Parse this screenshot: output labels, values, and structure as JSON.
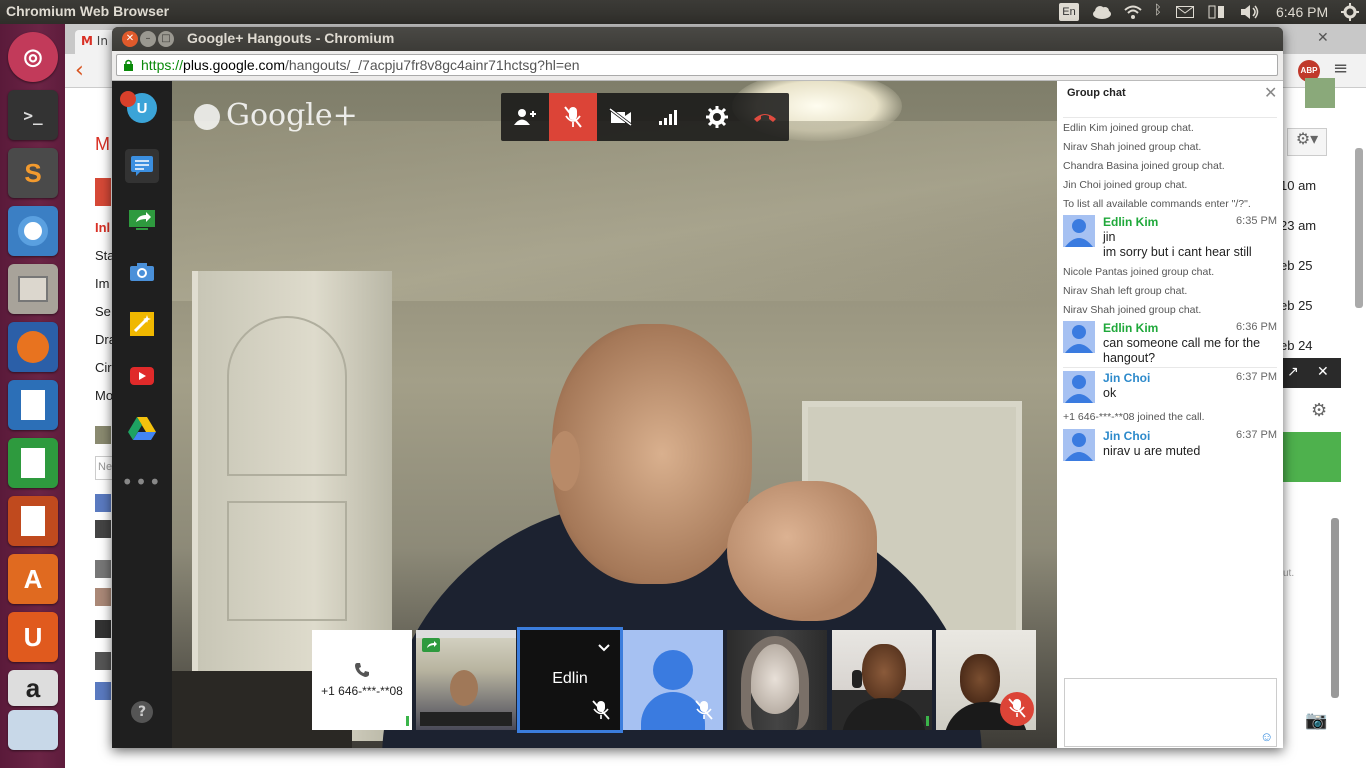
{
  "topbar": {
    "title": "Chromium Web Browser",
    "lang": "En",
    "clock": "6:46 PM"
  },
  "background_browser": {
    "tab_label": "In",
    "gmail_nav": [
      "M",
      "Inl",
      "Sta",
      "Im",
      "Se",
      "Dra",
      "Cir",
      "Mo"
    ],
    "dates": [
      "10 am",
      "23 am",
      "eb 25",
      "eb 25",
      "eb 24"
    ],
    "search_placeholder": "Ne",
    "side_note": "ut."
  },
  "hangout_window": {
    "title": "Google+ Hangouts - Chromium",
    "url_scheme": "https://",
    "url_host": "plus.google.com",
    "url_path": "/hangouts/_/7acpju7fr8v8gc4ainr71hctsg?hl=en",
    "logo": "Google+",
    "controls": [
      "invite-people-icon",
      "mute-mic-icon",
      "camera-off-icon",
      "bandwidth-icon",
      "settings-icon",
      "hang-up-icon"
    ],
    "thumbnails": [
      {
        "kind": "phone",
        "label": "+1 646-***-**08"
      },
      {
        "kind": "screen"
      },
      {
        "kind": "self",
        "label": "Edlin"
      },
      {
        "kind": "avatar"
      },
      {
        "kind": "person-female"
      },
      {
        "kind": "person-male-1"
      },
      {
        "kind": "person-male-2"
      }
    ]
  },
  "chat": {
    "header": "Group chat",
    "system": [
      "Edlin Kim joined group chat.",
      "Nirav Shah joined group chat.",
      "Chandra Basina joined group chat.",
      "Jin Choi joined group chat.",
      "To list all available commands enter \"/?\".",
      "Nicole Pantas joined group chat.",
      "Nirav Shah left group chat.",
      "Nirav Shah joined group chat.",
      "+1 646-***-**08 joined the call."
    ],
    "messages": [
      {
        "name": "Edlin Kim",
        "time": "6:35 PM",
        "text1": "jin",
        "text2": "im sorry but i cant hear still",
        "color": "#1fa83a"
      },
      {
        "name": "Edlin Kim",
        "time": "6:36 PM",
        "text1": "can someone call me for the hangout?",
        "color": "#1fa83a"
      },
      {
        "name": "Jin Choi",
        "time": "6:37 PM",
        "text1": "ok",
        "color": "#2d8acb"
      },
      {
        "name": "Jin Choi",
        "time": "6:37 PM",
        "text1": "nirav u are muted",
        "color": "#2d8acb"
      }
    ]
  }
}
